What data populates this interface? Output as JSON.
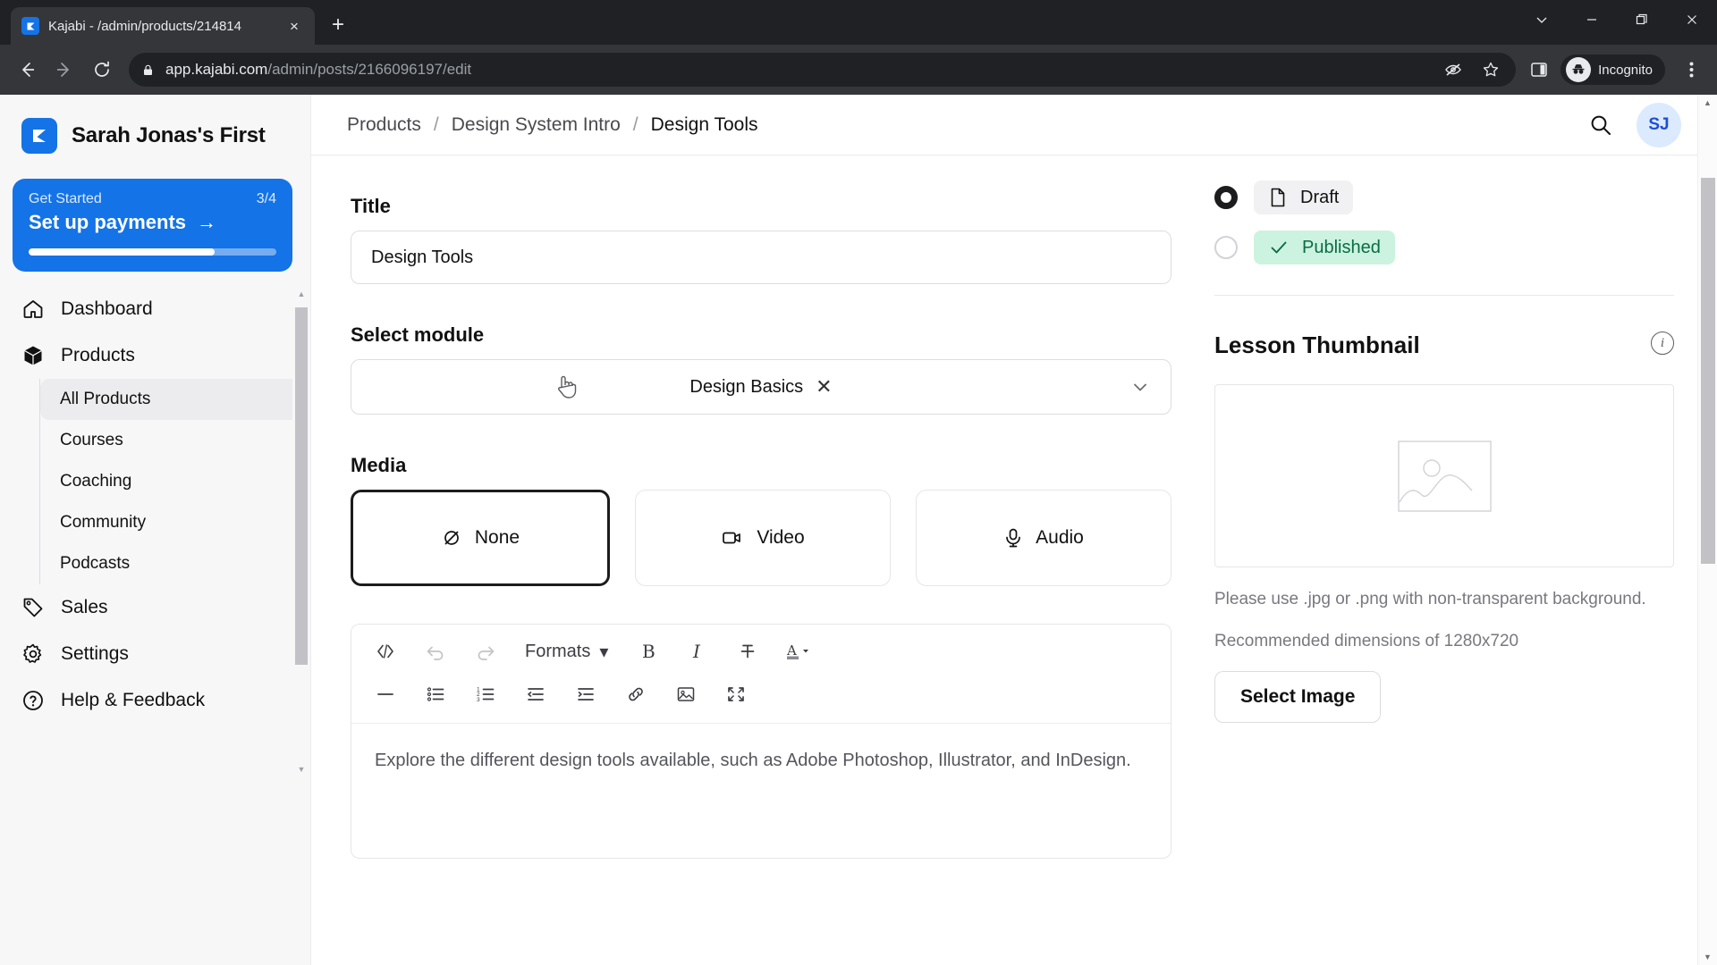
{
  "browser": {
    "tab_title": "Kajabi - /admin/products/214814",
    "tab_close_label": "×",
    "new_tab_label": "+",
    "url_host": "app.kajabi.com",
    "url_path": "/admin/posts/2166096197/edit",
    "profile_label": "Incognito",
    "window_minimize": "—",
    "window_maximize": "❐",
    "window_close": "✕"
  },
  "sidebar": {
    "brand_name": "Sarah Jonas's First",
    "get_started": {
      "label": "Get Started",
      "count": "3/4",
      "title": "Set up payments",
      "arrow": "→",
      "progress_percent": 75
    },
    "items": [
      {
        "label": "Dashboard",
        "icon": "home-icon"
      },
      {
        "label": "Products",
        "icon": "cube-icon"
      },
      {
        "label": "Sales",
        "icon": "tag-icon"
      },
      {
        "label": "Settings",
        "icon": "gear-icon"
      },
      {
        "label": "Help & Feedback",
        "icon": "help-circle-icon"
      }
    ],
    "sub_items": [
      {
        "label": "All Products",
        "active": true
      },
      {
        "label": "Courses",
        "active": false
      },
      {
        "label": "Coaching",
        "active": false
      },
      {
        "label": "Community",
        "active": false
      },
      {
        "label": "Podcasts",
        "active": false
      }
    ]
  },
  "header": {
    "breadcrumbs": [
      "Products",
      "Design System Intro",
      "Design Tools"
    ],
    "separator": "/",
    "avatar_initials": "SJ"
  },
  "form": {
    "title_label": "Title",
    "title_value": "Design Tools",
    "module_label": "Select module",
    "module_value": "Design Basics",
    "module_clear": "✕",
    "media_label": "Media",
    "media_options": [
      {
        "label": "None",
        "icon": "eye-off-icon",
        "selected": true
      },
      {
        "label": "Video",
        "icon": "video-camera-icon",
        "selected": false
      },
      {
        "label": "Audio",
        "icon": "microphone-icon",
        "selected": false
      }
    ]
  },
  "editor": {
    "formats_label": "Formats",
    "formats_caret": "▾",
    "toolbar_row1": [
      "code-icon",
      "undo-icon",
      "redo-icon",
      "formats-dropdown",
      "bold-icon",
      "italic-icon",
      "strikethrough-icon",
      "text-color-icon"
    ],
    "toolbar_row2": [
      "horizontal-rule-icon",
      "bullet-list-icon",
      "numbered-list-icon",
      "outdent-icon",
      "indent-icon",
      "link-icon",
      "image-icon",
      "fullscreen-icon"
    ],
    "body_text": "Explore the different design tools available, such as Adobe Photoshop, Illustrator, and InDesign."
  },
  "status": {
    "options": [
      {
        "label": "Draft",
        "icon": "document-icon",
        "selected": true
      },
      {
        "label": "Published",
        "icon": "check-icon",
        "selected": false
      }
    ]
  },
  "thumbnail": {
    "title": "Lesson Thumbnail",
    "info_icon": "info-icon",
    "placeholder_icon": "image-placeholder-icon",
    "hint_line1": "Please use .jpg or .png with non-transparent background.",
    "hint_line2": "Recommended dimensions of 1280x720",
    "button_label": "Select Image"
  },
  "colors": {
    "brand_blue": "#1473e6",
    "published_green": "#ccf3e0",
    "chrome_dark": "#202124"
  }
}
